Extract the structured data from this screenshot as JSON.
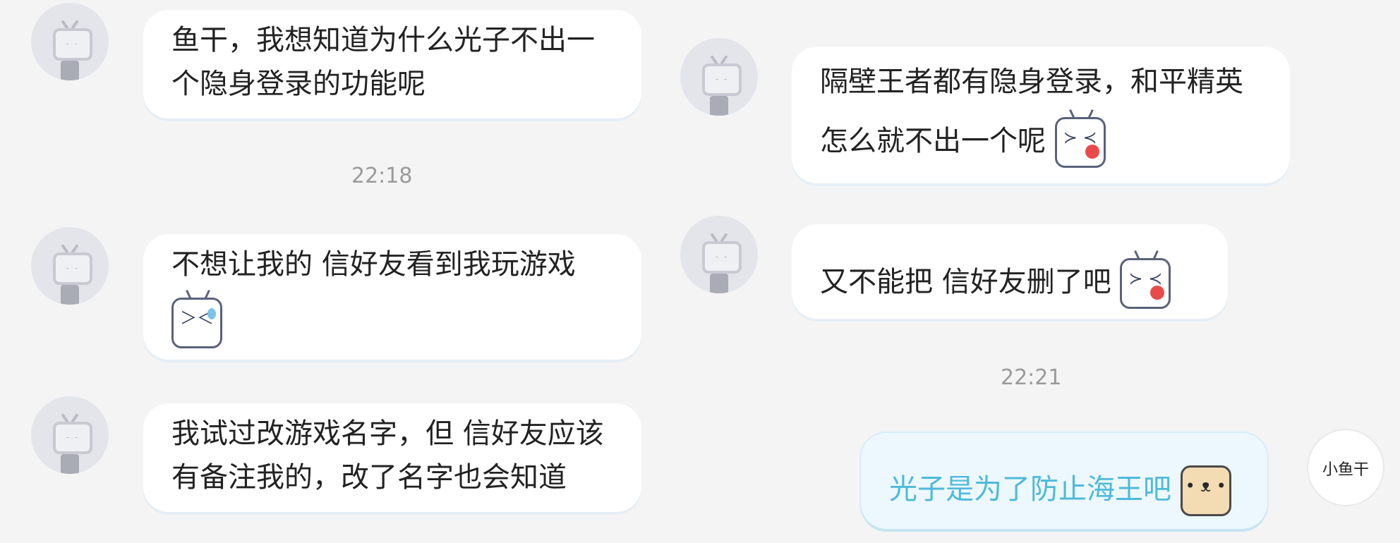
{
  "left_messages": [
    {
      "text": "鱼干，我想知道为什么光子不出一个隐身登录的功能呢"
    },
    {
      "text": "不想让我的 信好友看到我玩游戏",
      "emoji": "sweat-face-emoji"
    },
    {
      "text": "我试过改游戏名字，但 信好友应该有备注我的，改了名字也会知道"
    }
  ],
  "right_messages": [
    {
      "text": "隔壁王者都有隐身登录，和平精英怎么就不出一个呢",
      "emoji": "crying-face-emoji"
    },
    {
      "text": "又不能把 信好友删了吧",
      "emoji": "crying-face-emoji"
    }
  ],
  "my_message": {
    "text": "光子是为了防止海王吧",
    "emoji": "dog-face-emoji"
  },
  "timestamps": {
    "left": "22:18",
    "right": "22:21"
  },
  "user_avatar_text": "小鱼干",
  "colors": {
    "background": "#f4f4f4",
    "bubble": "#ffffff",
    "my_bubble": "#ecf8fd",
    "my_text": "#4fb9da"
  }
}
